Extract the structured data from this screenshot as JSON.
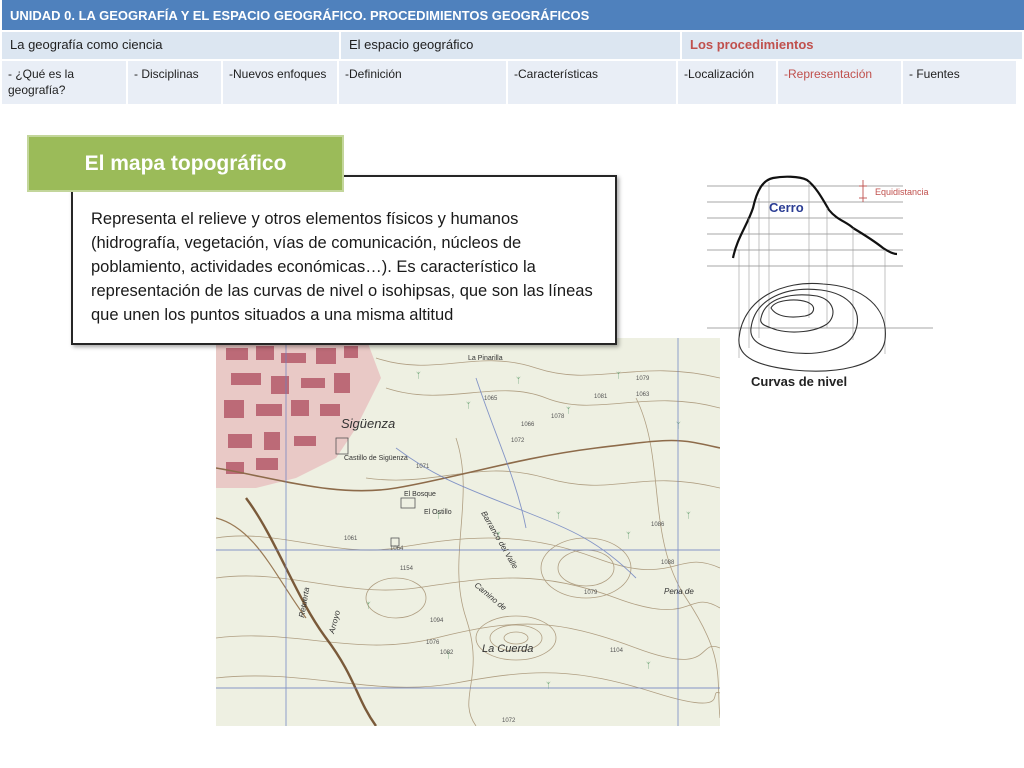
{
  "header": {
    "title": "UNIDAD 0.  LA GEOGRAFÍA Y EL ESPACIO GEOGRÁFICO. PROCEDIMIENTOS GEOGRÁFICOS"
  },
  "nav": {
    "items": [
      {
        "label": "La geografía como ciencia"
      },
      {
        "label": "El espacio geográfico"
      },
      {
        "label": "Los procedimientos"
      }
    ]
  },
  "subnav": {
    "items": [
      {
        "label": "-  ¿Qué es la geografía?"
      },
      {
        "label": "- Disciplinas"
      },
      {
        "label": "-Nuevos enfoques"
      },
      {
        "label": "-Definición"
      },
      {
        "label": "-Características"
      },
      {
        "label": "-Localización"
      },
      {
        "label": "-Representación"
      },
      {
        "label": "- Fuentes"
      }
    ]
  },
  "section": {
    "title": "El mapa topográfico",
    "description": "Representa  el relieve y otros elementos físicos y humanos (hidrografía, vegetación, vías de comunicación, núcleos de poblamiento, actividades económicas…). Es característico la representación de las curvas de nivel o isohipsas, que son las líneas que unen los puntos  situados a una misma altitud"
  },
  "diagram": {
    "peak_label": "Cerro",
    "interval_label": "Equidistancia",
    "caption": "Curvas de nivel"
  },
  "map": {
    "place_labels": [
      "Sigüenza",
      "Castillo de Sigüenza",
      "El Bosque",
      "El Ostillo",
      "La Cuerda",
      "La Pinarilla",
      "Barranco del Valle",
      "Camino de",
      "Pena de",
      "Arroyo",
      "Retuerta"
    ],
    "elevation_labels": [
      "1079",
      "1063",
      "1078",
      "1086",
      "1072",
      "1066",
      "1065",
      "1081",
      "1061",
      "1064",
      "1154",
      "1088",
      "1079",
      "1094",
      "1076",
      "1104",
      "1082",
      "1072",
      "1071"
    ]
  },
  "colors": {
    "header_bg": "#4f81bd",
    "nav_bg": "#dce6f1",
    "active_text": "#c0504d",
    "title_bg": "#9bbb59"
  }
}
